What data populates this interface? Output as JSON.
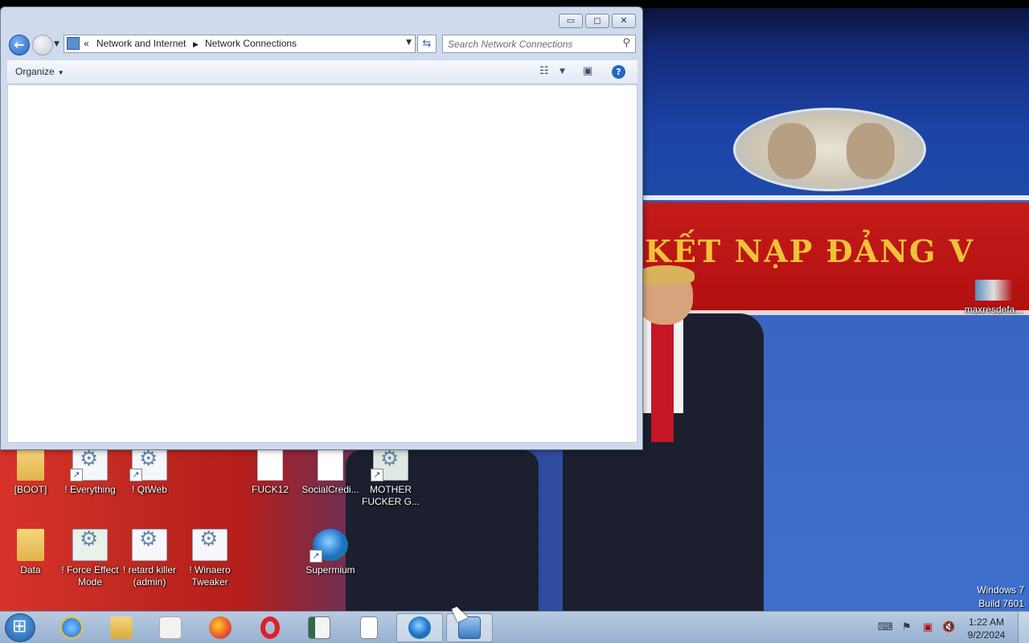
{
  "window": {
    "address": {
      "parent": "Network and Internet",
      "current": "Network Connections",
      "chevrons": "«"
    },
    "search_placeholder": "Search Network Connections",
    "toolbar": {
      "organize": "Organize"
    },
    "caption": {
      "minimize": "▭",
      "maximize": "◻",
      "close": "✕"
    }
  },
  "wallpaper": {
    "banner_text": "KẾT NẠP ĐẢNG V"
  },
  "desktop_icons": [
    {
      "label": "[BOOT]"
    },
    {
      "label": "! Everything"
    },
    {
      "label": "! QtWeb"
    },
    {
      "label": "FUCK12"
    },
    {
      "label": "SocialCredi..."
    },
    {
      "label": "MOTHER FUCKER G..."
    },
    {
      "label": "Data"
    },
    {
      "label": "! Force Effect Mode"
    },
    {
      "label": "! retard killer (admin)"
    },
    {
      "label": "! Winaero Tweaker"
    },
    {
      "label": "Supermium"
    },
    {
      "label": "maxresdefa..."
    }
  ],
  "watermark": {
    "line1": "Windows 7",
    "line2": "Build 7601"
  },
  "taskbar": {
    "apps": [
      "internet-explorer",
      "windows-explorer",
      "media-player",
      "firefox",
      "opera",
      "notepad",
      "folder",
      "supermium",
      "network-control-panel"
    ],
    "clock_time": "1:22 AM",
    "clock_date": "9/2/2024"
  },
  "colors": {
    "window_frame": "#cfdbec",
    "taskbar": "#a6bdd8",
    "banner_red": "#c51a1a",
    "banner_text": "#f1c13a"
  }
}
